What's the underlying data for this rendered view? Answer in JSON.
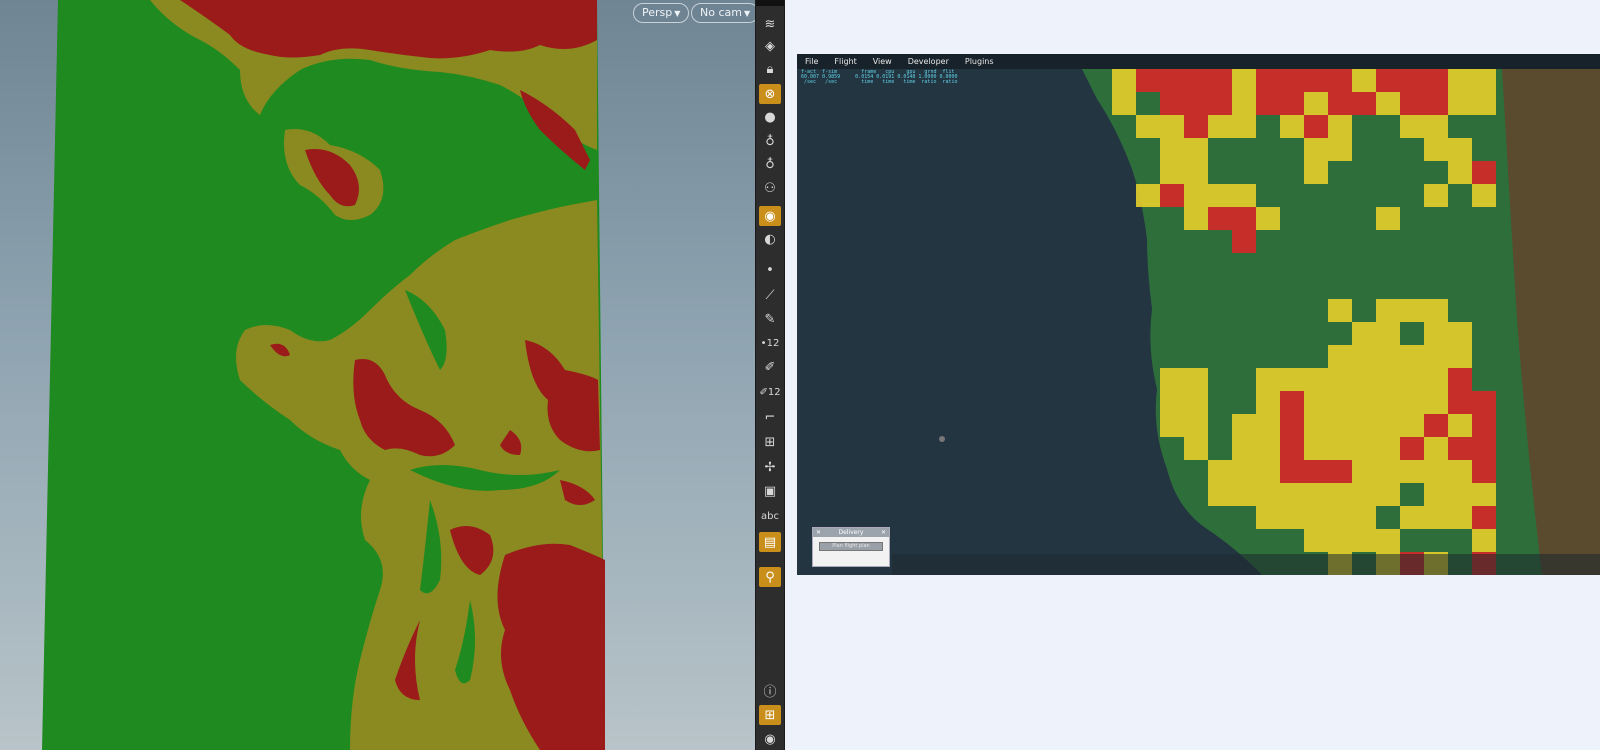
{
  "viewport": {
    "view_menu_label": "Persp",
    "camera_menu_label": "No cam",
    "colors": {
      "green": "#1f8a1f",
      "olive": "#8a8a20",
      "red": "#9b1a1a"
    }
  },
  "toolbar": {
    "icons": [
      "view-visibility-icon",
      "geometry-select-icon",
      "lock-icon",
      "display-options-icon",
      "shading-sphere-icon",
      "light-icon",
      "spot-light-icon",
      "camera-light-icon",
      "background-icon",
      "eye-toggle-icon",
      "point-icon",
      "edge-tool-icon",
      "pen-tool-icon",
      "numbered-points-icon",
      "paint-brush-icon",
      "numbered-brush-icon",
      "corner-tool-icon",
      "snap-grid-icon",
      "transform-handles-icon",
      "square-display-icon",
      "text-icon",
      "image-display-icon",
      "pin-icon",
      "info-icon",
      "layout-grid-icon",
      "visibility-eye-icon"
    ],
    "text_tool_label": "abc",
    "points_label": "12",
    "brush_label": "12"
  },
  "sim": {
    "menu": [
      "File",
      "Flight",
      "View",
      "Developer",
      "Plugins"
    ],
    "stats_text": "f-act  f-sim        frame   cpu    gpu   grnd  flit\n60.007 0.9859     0.0154 0.0191 0.0148 1.0000 0.0000\n /sec   /sec        time   time   time  ratio  ratio",
    "delivery": {
      "title": "Delivery",
      "button_label": "Plan flight plan"
    },
    "colors": {
      "sea": "#243542",
      "land": "#2e6e3a",
      "yellow": "#e2cc2a",
      "red": "#d42828"
    }
  }
}
